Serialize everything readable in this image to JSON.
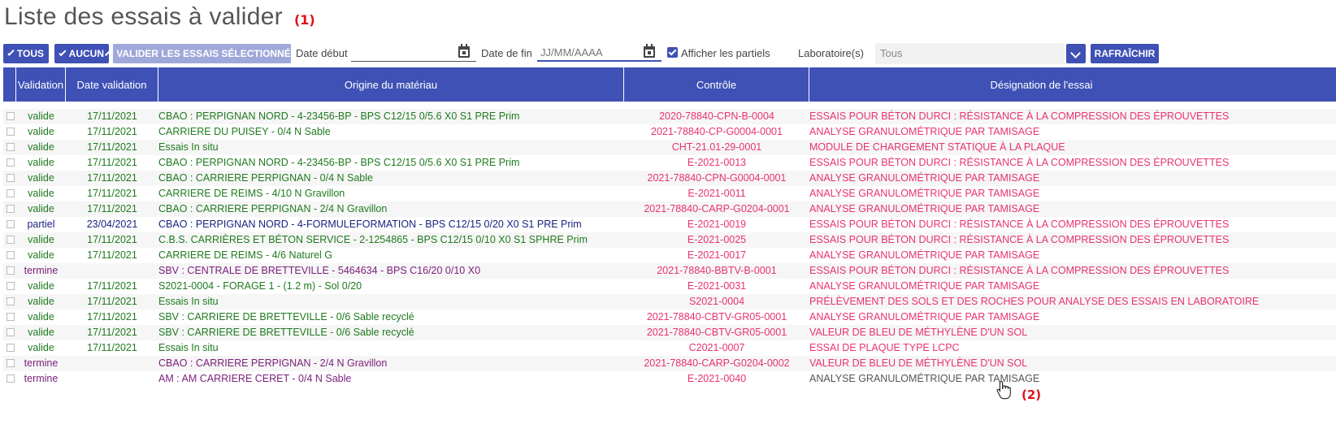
{
  "page": {
    "title": "Liste des essais à valider",
    "annotation_1": "(1)",
    "annotation_2": "(2)"
  },
  "toolbar": {
    "all_label": "TOUS",
    "none_label": "AUCUN",
    "validate_label": "VALIDER LES ESSAIS SÉLECTIONNÉS",
    "start_date_label": "Date début",
    "start_date_value": "",
    "end_date_label": "Date de fin",
    "end_date_placeholder": "JJ/MM/AAAA",
    "show_partial_label": "Afficher les partiels",
    "show_partial_checked": true,
    "lab_label": "Laboratoire(s)",
    "lab_value": "Tous",
    "refresh_label": "RAFRAÎCHIR"
  },
  "table": {
    "headers": {
      "validation": "Validation",
      "date": "Date validation",
      "origin": "Origine du matériau",
      "control": "Contrôle",
      "designation": "Désignation de l'essai"
    },
    "rows": [
      {
        "status": "valide",
        "date": "17/11/2021",
        "origin": "CBAO : PERPIGNAN NORD - 4-23456-BP - BPS C12/15 0/5.6 X0 S1 PRE Prim",
        "control": "2020-78840-CPN-B-0004",
        "designation": "ESSAIS POUR BÉTON DURCI : RÉSISTANCE À LA COMPRESSION DES ÉPROUVETTES",
        "tone": "green",
        "dtone": "red"
      },
      {
        "status": "valide",
        "date": "17/11/2021",
        "origin": "CARRIERE DU PUISEY - 0/4 N Sable",
        "control": "2021-78840-CP-G0004-0001",
        "designation": "ANALYSE GRANULOMÉTRIQUE PAR TAMISAGE",
        "tone": "green",
        "dtone": "red"
      },
      {
        "status": "valide",
        "date": "17/11/2021",
        "origin": "Essais In situ",
        "control": "CHT-21.01-29-0001",
        "designation": "MODULE DE CHARGEMENT STATIQUE À LA PLAQUE",
        "tone": "green",
        "dtone": "red"
      },
      {
        "status": "valide",
        "date": "17/11/2021",
        "origin": "CBAO : PERPIGNAN NORD - 4-23456-BP - BPS C12/15 0/5.6 X0 S1 PRE Prim",
        "control": "E-2021-0013",
        "designation": "ESSAIS POUR BÉTON DURCI : RÉSISTANCE À LA COMPRESSION DES ÉPROUVETTES",
        "tone": "green",
        "dtone": "red"
      },
      {
        "status": "valide",
        "date": "17/11/2021",
        "origin": "CBAO : CARRIERE PERPIGNAN - 0/4 N Sable",
        "control": "2021-78840-CPN-G0004-0001",
        "designation": "ANALYSE GRANULOMÉTRIQUE PAR TAMISAGE",
        "tone": "green",
        "dtone": "red"
      },
      {
        "status": "valide",
        "date": "17/11/2021",
        "origin": "CARRIERE DE REIMS - 4/10 N Gravillon",
        "control": "E-2021-0011",
        "designation": "ANALYSE GRANULOMÉTRIQUE PAR TAMISAGE",
        "tone": "green",
        "dtone": "red"
      },
      {
        "status": "valide",
        "date": "17/11/2021",
        "origin": "CBAO : CARRIERE PERPIGNAN - 2/4 N Gravillon",
        "control": "2021-78840-CARP-G0204-0001",
        "designation": "ANALYSE GRANULOMÉTRIQUE PAR TAMISAGE",
        "tone": "green",
        "dtone": "red"
      },
      {
        "status": "partiel",
        "date": "23/04/2021",
        "origin": "CBAO : PERPIGNAN NORD - 4-FORMULEFORMATION - BPS C12/15 0/20 X0 S1 PRE Prim",
        "control": "E-2021-0019",
        "designation": "ESSAIS POUR BÉTON DURCI : RÉSISTANCE À LA COMPRESSION DES ÉPROUVETTES",
        "tone": "blue",
        "dtone": "red"
      },
      {
        "status": "valide",
        "date": "17/11/2021",
        "origin": "C.B.S. CARRIÈRES ET BÉTON SERVICE - 2-1254865 - BPS C12/15 0/10 X0 S1 SPHRE Prim",
        "control": "E-2021-0025",
        "designation": "ESSAIS POUR BÉTON DURCI : RÉSISTANCE À LA COMPRESSION DES ÉPROUVETTES",
        "tone": "green",
        "dtone": "red"
      },
      {
        "status": "valide",
        "date": "17/11/2021",
        "origin": "CARRIERE DE REIMS - 4/6 Naturel G",
        "control": "E-2021-0017",
        "designation": "ANALYSE GRANULOMÉTRIQUE PAR TAMISAGE",
        "tone": "green",
        "dtone": "red"
      },
      {
        "status": "termine",
        "date": "",
        "origin": "SBV : CENTRALE DE BRETTEVILLE - 5464634 - BPS C16/20 0/10 X0",
        "control": "2021-78840-BBTV-B-0001",
        "designation": "ESSAIS POUR BÉTON DURCI : RÉSISTANCE À LA COMPRESSION DES ÉPROUVETTES",
        "tone": "purple",
        "dtone": "red"
      },
      {
        "status": "valide",
        "date": "17/11/2021",
        "origin": "S2021-0004 - FORAGE 1 - (1.2 m) - Sol 0/20",
        "control": "E-2021-0031",
        "designation": "ANALYSE GRANULOMÉTRIQUE PAR TAMISAGE",
        "tone": "green",
        "dtone": "red"
      },
      {
        "status": "valide",
        "date": "17/11/2021",
        "origin": "Essais In situ",
        "control": "S2021-0004",
        "designation": "PRÉLÈVEMENT DES SOLS ET DES ROCHES POUR ANALYSE DES ESSAIS EN LABORATOIRE",
        "tone": "green",
        "dtone": "red"
      },
      {
        "status": "valide",
        "date": "17/11/2021",
        "origin": "SBV : CARRIERE DE BRETTEVILLE - 0/6 Sable recyclé",
        "control": "2021-78840-CBTV-GR05-0001",
        "designation": "ANALYSE GRANULOMÉTRIQUE PAR TAMISAGE",
        "tone": "green",
        "dtone": "red"
      },
      {
        "status": "valide",
        "date": "17/11/2021",
        "origin": "SBV : CARRIERE DE BRETTEVILLE - 0/6 Sable recyclé",
        "control": "2021-78840-CBTV-GR05-0001",
        "designation": "VALEUR DE BLEU DE MÉTHYLÈNE D'UN SOL",
        "tone": "green",
        "dtone": "red"
      },
      {
        "status": "valide",
        "date": "17/11/2021",
        "origin": "Essais In situ",
        "control": "C2021-0007",
        "designation": "ESSAI DE PLAQUE TYPE LCPC",
        "tone": "green",
        "dtone": "red"
      },
      {
        "status": "termine",
        "date": "",
        "origin": "CBAO : CARRIERE PERPIGNAN - 2/4 N Gravillon",
        "control": "2021-78840-CARP-G0204-0002",
        "designation": "VALEUR DE BLEU DE MÉTHYLÈNE D'UN SOL",
        "tone": "purple",
        "dtone": "red"
      },
      {
        "status": "termine",
        "date": "",
        "origin": "AM : AM CARRIERE CERET - 0/4 N Sable",
        "control": "E-2021-0040",
        "designation": "ANALYSE GRANULOMÉTRIQUE PAR TAMISAGE",
        "tone": "purple",
        "dtone": "gray"
      }
    ]
  },
  "colors": {
    "primary": "#3f51b5",
    "valide": "#1f7a1f",
    "partiel": "#1a237e",
    "termine": "#7b1e7a",
    "control_text": "#e8336f",
    "annotation": "#e0101a"
  }
}
